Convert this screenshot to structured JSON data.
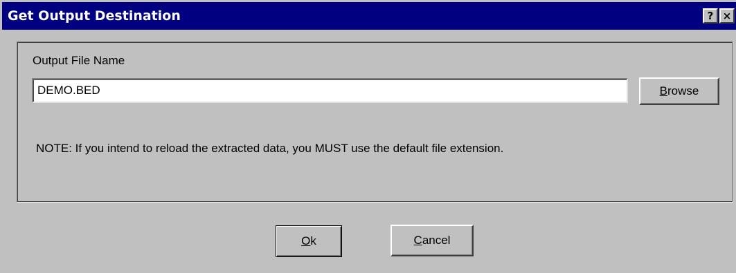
{
  "window": {
    "title": "Get Output Destination",
    "help_glyph": "?",
    "close_glyph": "×",
    "colors": {
      "titlebar": "#000080",
      "face": "#c0c0c0"
    }
  },
  "form": {
    "field_label": "Output File Name",
    "output_file": "DEMO.BED",
    "browse": {
      "mnemonic": "B",
      "rest": "rowse"
    },
    "note": "NOTE: If you intend to reload the extracted data, you MUST use the default file extension."
  },
  "buttons": {
    "ok": {
      "mnemonic": "O",
      "rest": "k"
    },
    "cancel": {
      "mnemonic": "C",
      "rest": "ancel"
    }
  }
}
